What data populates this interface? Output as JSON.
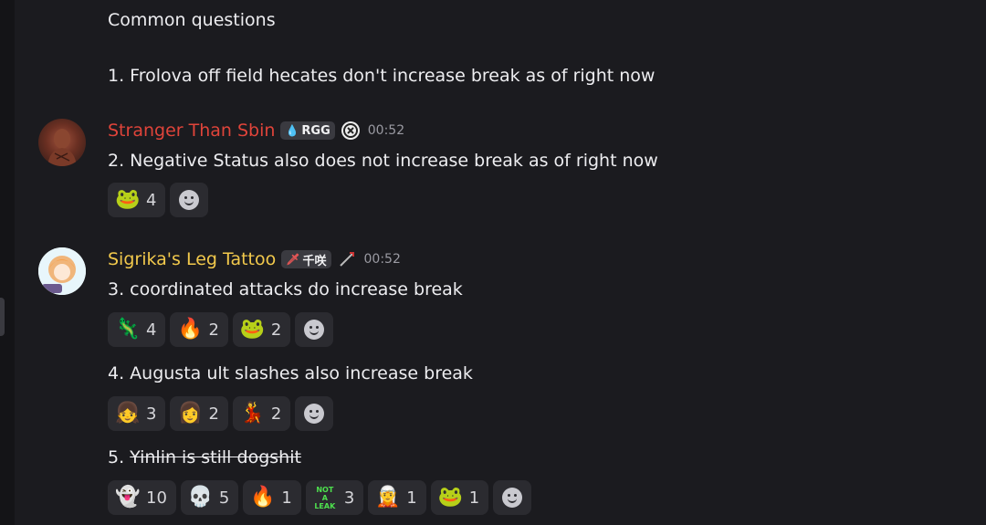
{
  "messages": {
    "m0": {
      "title": "Common questions",
      "text": "1. Frolova off field hecates don't increase break as of right now"
    },
    "m1": {
      "username": "Stranger Than Sbin",
      "tag_label": "RGG",
      "timestamp": "00:52",
      "text": "2. Negative Status also does not increase break as of right now",
      "reactions": [
        {
          "emoji": "pepe-cry-emoji",
          "count": "4"
        }
      ]
    },
    "m2": {
      "username": "Sigrika's Leg Tattoo",
      "tag_label": "千咲",
      "timestamp": "00:52",
      "text": "3. coordinated attacks do increase break",
      "reactions": [
        {
          "emoji": "frog-emoji",
          "count": "4"
        },
        {
          "emoji": "fire-emoji",
          "count": "2"
        },
        {
          "emoji": "pepe-cry-emoji",
          "count": "2"
        }
      ]
    },
    "m3": {
      "text": "4. Augusta ult slashes also increase break",
      "reactions": [
        {
          "emoji": "anime-girl-emoji",
          "count": "3"
        },
        {
          "emoji": "anime-girl-emoji-2",
          "count": "2"
        },
        {
          "emoji": "anime-girl-emoji-3",
          "count": "2"
        }
      ]
    },
    "m4": {
      "prefix": "5. ",
      "struck_text": "Yinlin is still dogshit",
      "leak_line1": "NOT A",
      "leak_line2": "LEAK",
      "reactions": [
        {
          "emoji": "ghost-emoji",
          "count": "10"
        },
        {
          "emoji": "skull-emoji",
          "count": "5"
        },
        {
          "emoji": "fire-emoji",
          "count": "1"
        },
        {
          "emoji": "not-a-leak-emoji",
          "count": "3"
        },
        {
          "emoji": "character-emoji",
          "count": "1"
        },
        {
          "emoji": "pepe-cry-emoji",
          "count": "1"
        }
      ]
    }
  },
  "colors": {
    "background": "#1b1b1f",
    "username_red": "#e0443a",
    "username_gold": "#f2c94c",
    "reaction_bg": "#2b2b30"
  }
}
